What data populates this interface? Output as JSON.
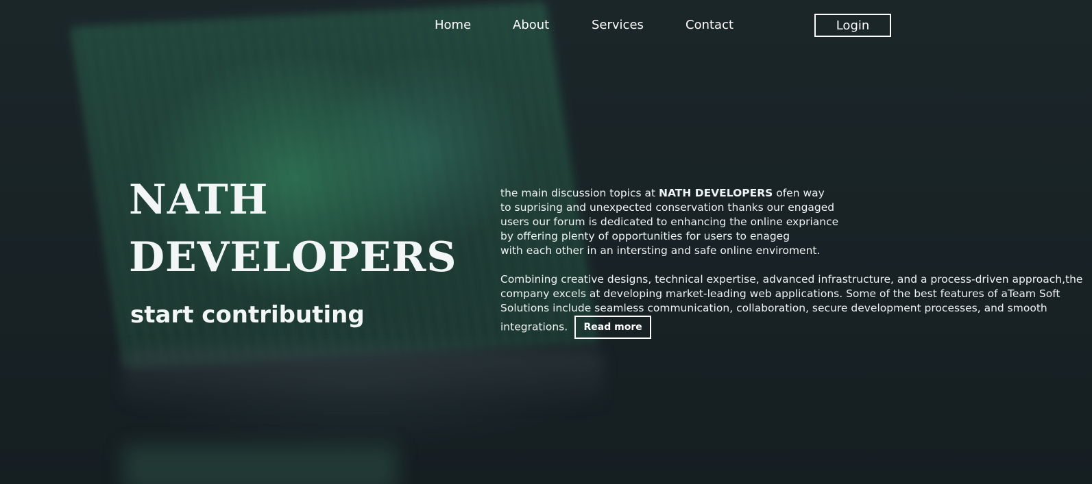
{
  "nav": {
    "links": [
      {
        "label": "Home"
      },
      {
        "label": "About"
      },
      {
        "label": "Services"
      },
      {
        "label": "Contact"
      }
    ],
    "login_label": "Login"
  },
  "hero": {
    "title_line1": "NATH",
    "title_line2": "DEVELOPERS",
    "subtitle": "start contributing"
  },
  "about": {
    "p1_prefix": "the main discussion topics at ",
    "p1_brand": "NATH DEVELOPERS",
    "p1_suffix": " ofen way\nto suprising and unexpected conservation thanks our engaged\nusers our forum is dedicated to enhancing the online expriance\nby offering plenty of opportunities for users to enageg\nwith each other in an intersting and safe online enviroment.",
    "p2": "Combining creative designs, technical expertise, advanced infrastructure, and a process-driven approach,the company excels at developing market-leading web applications. Some of the best features of aTeam Soft Solutions include seamless communication, collaboration, secure development processes, and smooth integrations.",
    "read_more_label": "Read more"
  }
}
